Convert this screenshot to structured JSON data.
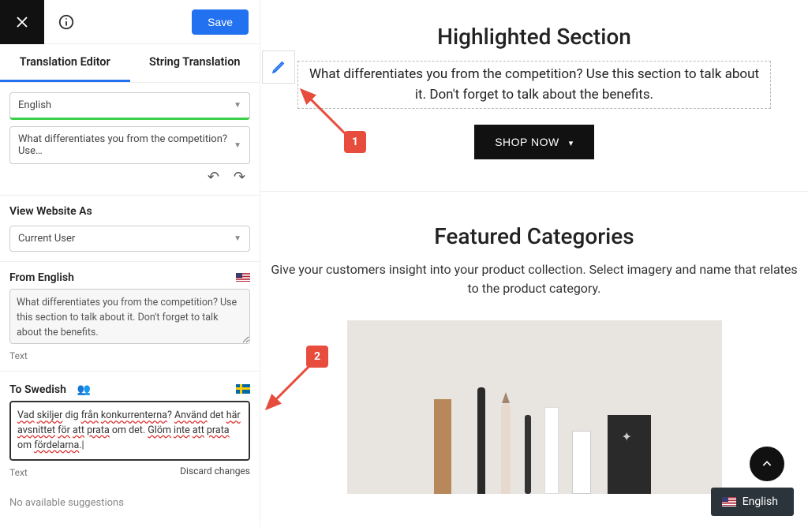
{
  "sidebar": {
    "save_label": "Save",
    "tabs": {
      "editor": "Translation Editor",
      "strings": "String Translation"
    },
    "source_language": "English",
    "string_preview": "What differentiates you from the competition? Use…",
    "view_as_label": "View Website As",
    "view_as_value": "Current User",
    "from_label": "From English",
    "from_text": "What differentiates you from the competition? Use this section to talk about it. Don't forget to talk about the benefits.",
    "type_label_from": "Text",
    "to_label": "To Swedish",
    "to_text": "Vad skiljer dig från konkurrenterna? Använd det här avsnittet för att prata om det. Glöm inte att prata om fördelarna.",
    "type_label_to": "Text",
    "discard_label": "Discard changes",
    "no_suggestions": "No available suggestions"
  },
  "callouts": {
    "one": "1",
    "two": "2"
  },
  "preview": {
    "highlighted_title": "Highlighted Section",
    "highlighted_desc": "What differentiates you from the competition? Use this section to talk about it. Don't forget to talk about the benefits.",
    "shop_label": "SHOP NOW",
    "featured_title": "Featured Categories",
    "featured_desc": "Give your customers insight into your product collection. Select imagery and name that relates to the product category.",
    "lang_switcher": "English"
  }
}
